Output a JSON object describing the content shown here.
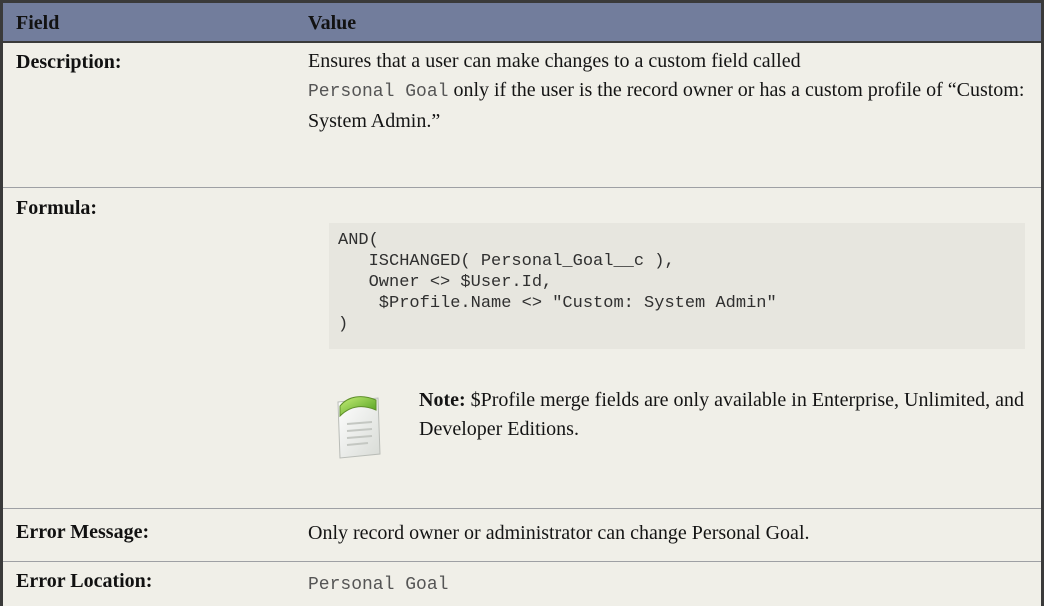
{
  "table": {
    "headers": {
      "field": "Field",
      "value": "Value"
    },
    "rows": {
      "description": {
        "label": "Description:",
        "text_before": "Ensures that a user can make changes to a custom field called",
        "code": "Personal Goal",
        "text_after": "only if the user is the record owner or has a custom profile of “Custom: System Admin.”"
      },
      "formula": {
        "label": "Formula:",
        "code_lines": [
          "AND(",
          "   ISCHANGED( Personal_Goal__c ),",
          "   Owner <> $User.Id,",
          "    $Profile.Name <> \"Custom: System Admin\"",
          ")"
        ],
        "note_label": "Note:",
        "note_text": "$Profile merge fields are only available in Enterprise, Unlimited, and Developer Editions."
      },
      "error_message": {
        "label": "Error Message:",
        "value": "Only record owner or administrator can change Personal Goal."
      },
      "error_location": {
        "label": "Error Location:",
        "value": "Personal Goal"
      }
    }
  },
  "icons": {
    "note": "note-icon"
  }
}
